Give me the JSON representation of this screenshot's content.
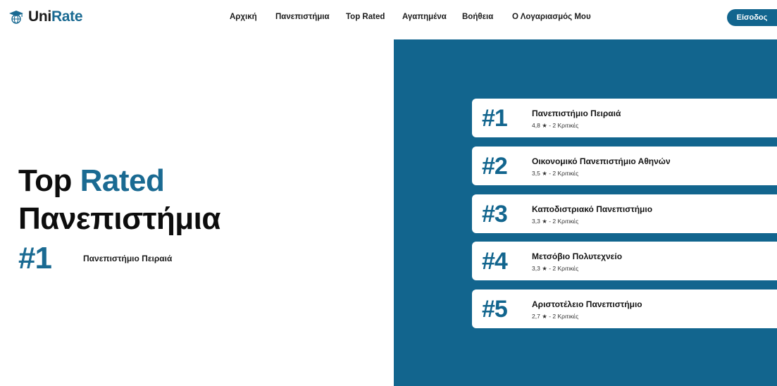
{
  "brand": {
    "name_part1": "Uni",
    "name_part2": "Rate",
    "icon": "graduation-cap-globe-icon",
    "accent_color": "#1a6a92"
  },
  "nav": {
    "items": [
      {
        "label": "Αρχική"
      },
      {
        "label": "Πανεπιστήμια"
      },
      {
        "label": "Top Rated"
      },
      {
        "label": "Αγαπημένα"
      },
      {
        "label": "Βοήθεια"
      },
      {
        "label": "Ο Λογαριασμός Μου"
      }
    ],
    "login_label": "Είσοδος"
  },
  "hero": {
    "title_part1": "Top",
    "title_accent": "Rated",
    "title_line2": "Πανεπιστήμια",
    "top_rank": "#1",
    "top_name": "Πανεπιστήμιο Πειραιά"
  },
  "ranking": {
    "panel_color": "#12658e",
    "items": [
      {
        "rank": "#1",
        "name": "Πανεπιστήμιο Πειραιά",
        "rating": "4,8",
        "star": "★",
        "reviews": "- 2 Κριτικές"
      },
      {
        "rank": "#2",
        "name": "Οικονομικό Πανεπιστήμιο Αθηνών",
        "rating": "3,5",
        "star": "★",
        "reviews": "- 2 Κριτικές"
      },
      {
        "rank": "#3",
        "name": "Καποδιστριακό Πανεπιστήμιο",
        "rating": "3,3",
        "star": "★",
        "reviews": "- 2 Κριτικές"
      },
      {
        "rank": "#4",
        "name": "Μετσόβιο Πολυτεχνείο",
        "rating": "3,3",
        "star": "★",
        "reviews": "- 2 Κριτικές"
      },
      {
        "rank": "#5",
        "name": "Αριστοτέλειο Πανεπιστήμιο",
        "rating": "2,7",
        "star": "★",
        "reviews": "- 2 Κριτικές"
      }
    ]
  }
}
